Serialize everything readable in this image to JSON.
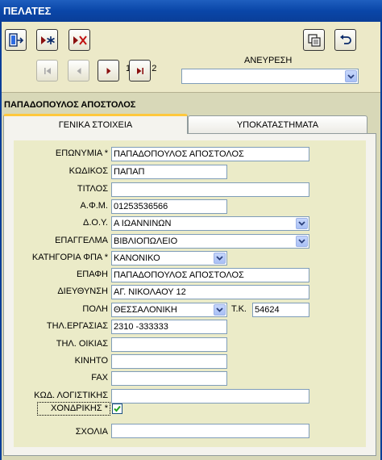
{
  "window": {
    "title": "ΠΕΛΑΤΕΣ"
  },
  "toolbar": {
    "exit_icon": "exit-door-icon",
    "new_icon": "new-record-icon",
    "delete_icon": "delete-record-icon",
    "copy_icon": "copy-record-icon",
    "undo_icon": "undo-icon",
    "record_counter": "1 από 2",
    "search_label": "ΑΝΕΥΡΕΣΗ",
    "search_value": ""
  },
  "navigation": {
    "first_enabled": false,
    "previous_enabled": false,
    "next_enabled": true,
    "last_enabled": true
  },
  "customer_heading": "ΠΑΠΑΔΟΠΟΥΛΟΣ ΑΠΟΣΤΟΛΟΣ",
  "tabs": [
    {
      "label": "ΓΕΝΙΚΑ ΣΤΟΙΧΕΙΑ",
      "active": true
    },
    {
      "label": "ΥΠΟΚΑΤΑΣΤΗΜΑΤΑ",
      "active": false
    }
  ],
  "form": {
    "surname": {
      "label": "ΕΠΩΝΥΜΙΑ *",
      "value": "ΠΑΠΑΔΟΠΟΥΛΟΣ ΑΠΟΣΤΟΛΟΣ"
    },
    "code": {
      "label": "ΚΩΔΙΚΟΣ",
      "value": "ΠΑΠΑΠ"
    },
    "title": {
      "label": "ΤΙΤΛΟΣ",
      "value": ""
    },
    "afm": {
      "label": "Α.Φ.Μ.",
      "value": "01253536566"
    },
    "doy": {
      "label": "Δ.Ο.Υ.",
      "value": "Α ΙΩΑΝΝΙΝΩΝ"
    },
    "profession": {
      "label": "ΕΠΑΓΓΕΛΜΑ",
      "value": "ΒΙΒΛΙΟΠΩΛΕΙΟ"
    },
    "vat_category": {
      "label": "ΚΑΤΗΓΟΡΙΑ ΦΠΑ *",
      "value": "ΚΑΝΟΝΙΚΟ"
    },
    "contact": {
      "label": "ΕΠΑΦΗ",
      "value": "ΠΑΠΑΔΟΠΟΥΛΟΣ ΑΠΟΣΤΟΛΟΣ"
    },
    "address": {
      "label": "ΔΙΕΥΘΥΝΣΗ",
      "value": "ΑΓ. ΝΙΚΟΛΑΟΥ 12"
    },
    "city": {
      "label": "ΠΟΛΗ",
      "value": "ΘΕΣΣΑΛΟΝΙΚΗ"
    },
    "postal_code": {
      "label": "Τ.Κ.",
      "value": "54624"
    },
    "work_phone": {
      "label": "ΤΗΛ.ΕΡΓΑΣΙΑΣ",
      "value": "2310 -333333"
    },
    "home_phone": {
      "label": "ΤΗΛ. ΟΙΚΙΑΣ",
      "value": ""
    },
    "mobile": {
      "label": "ΚΙΝΗΤΟ",
      "value": ""
    },
    "fax": {
      "label": "FAX",
      "value": ""
    },
    "accounting_code": {
      "label": "ΚΩΔ. ΛΟΓΙΣΤΙΚΗΣ",
      "value": ""
    },
    "wholesale": {
      "label": "ΧΟΝΔΡΙΚΗΣ *",
      "checked": true
    },
    "comments": {
      "label": "ΣΧΟΛΙΑ",
      "value": ""
    }
  },
  "colors": {
    "titlebar": "#0a46a8",
    "form_background": "#ebebc8",
    "active_tab_accent": "#ffc83c",
    "nav_arrow": "#8b1010"
  }
}
